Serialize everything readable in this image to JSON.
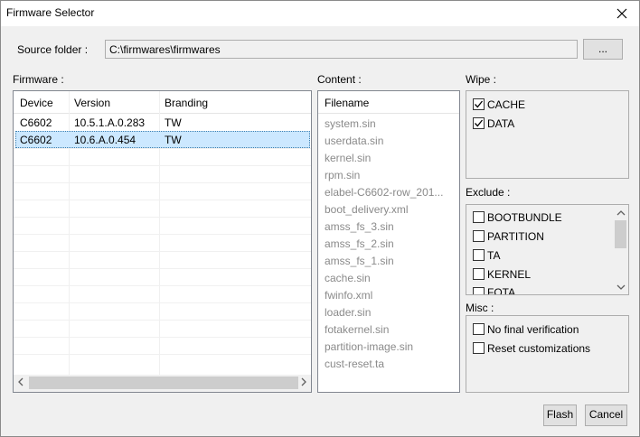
{
  "window": {
    "title": "Firmware Selector"
  },
  "source": {
    "label": "Source folder :",
    "value": "C:\\firmwares\\firmwares",
    "browse_label": "..."
  },
  "firmware": {
    "label": "Firmware :",
    "columns": [
      "Device",
      "Version",
      "Branding"
    ],
    "rows": [
      {
        "device": "C6602",
        "version": "10.5.1.A.0.283",
        "branding": "TW"
      },
      {
        "device": "C6602",
        "version": "10.6.A.0.454",
        "branding": "TW"
      }
    ]
  },
  "content": {
    "label": "Content :",
    "header": "Filename",
    "items": [
      "system.sin",
      "userdata.sin",
      "kernel.sin",
      "rpm.sin",
      "elabel-C6602-row_201...",
      "boot_delivery.xml",
      "amss_fs_3.sin",
      "amss_fs_2.sin",
      "amss_fs_1.sin",
      "cache.sin",
      "fwinfo.xml",
      "loader.sin",
      "fotakernel.sin",
      "partition-image.sin",
      "cust-reset.ta"
    ]
  },
  "wipe": {
    "label": "Wipe :",
    "items": [
      {
        "label": "CACHE",
        "checked": true
      },
      {
        "label": "DATA",
        "checked": true
      }
    ]
  },
  "exclude": {
    "label": "Exclude :",
    "items": [
      {
        "label": "BOOTBUNDLE",
        "checked": false
      },
      {
        "label": "PARTITION",
        "checked": false
      },
      {
        "label": "TA",
        "checked": false
      },
      {
        "label": "KERNEL",
        "checked": false
      },
      {
        "label": "FOTA",
        "checked": false
      }
    ]
  },
  "misc": {
    "label": "Misc :",
    "items": [
      {
        "label": "No final verification",
        "checked": false
      },
      {
        "label": "Reset customizations",
        "checked": false
      }
    ]
  },
  "buttons": {
    "flash": "Flash",
    "cancel": "Cancel"
  }
}
